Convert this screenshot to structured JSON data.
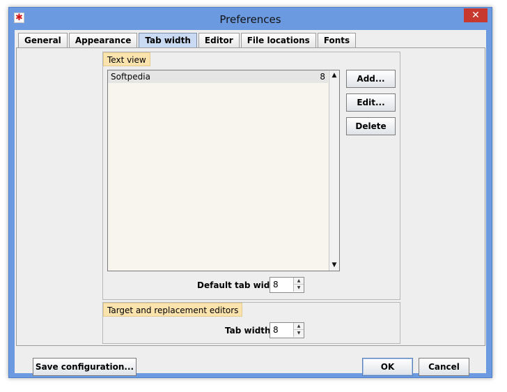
{
  "window": {
    "title": "Preferences",
    "close_glyph": "✕",
    "app_icon_glyph": "✱"
  },
  "tabs": [
    "General",
    "Appearance",
    "Tab width",
    "Editor",
    "File locations",
    "Fonts"
  ],
  "active_tab": "Tab width",
  "text_view": {
    "title": "Text view",
    "rows": [
      {
        "name": "Softpedia",
        "width": "8"
      }
    ],
    "buttons": {
      "add": "Add...",
      "edit": "Edit...",
      "delete": "Delete"
    },
    "default_width_label": "Default tab width:",
    "default_width_value": "8"
  },
  "target": {
    "title": "Target and replacement editors",
    "width_label": "Tab width:",
    "width_value": "8"
  },
  "footer": {
    "save_label": "Save configuration...",
    "ok_label": "OK",
    "cancel_label": "Cancel"
  },
  "colors": {
    "titlebar": "#6b9ae0",
    "close_button": "#c7382f",
    "group_title_bg": "#fbe3ae",
    "list_bg": "#f7f5ee",
    "active_tab": "#c9daf2"
  }
}
